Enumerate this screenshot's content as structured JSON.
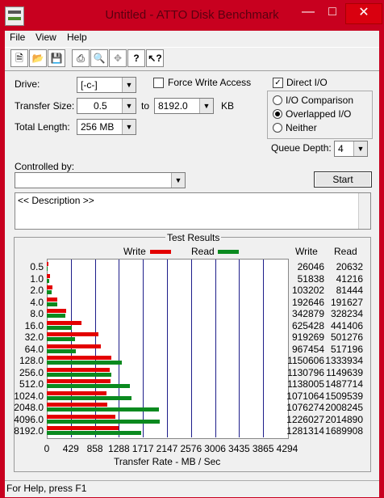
{
  "window": {
    "title": "Untitled - ATTO Disk Benchmark"
  },
  "menu": {
    "file": "File",
    "view": "View",
    "help": "Help"
  },
  "form": {
    "drive_label": "Drive:",
    "drive_value": "[-c-]",
    "transfer_size_label": "Transfer Size:",
    "transfer_from": "0.5",
    "to_label": "to",
    "transfer_to": "8192.0",
    "kb_label": "KB",
    "total_length_label": "Total Length:",
    "total_length_value": "256 MB",
    "force_write_label": "Force Write Access",
    "force_write_checked": false,
    "direct_io_label": "Direct I/O",
    "direct_io_checked": true,
    "io_comparison_label": "I/O Comparison",
    "overlapped_io_label": "Overlapped I/O",
    "neither_label": "Neither",
    "io_mode_selected": "Overlapped I/O",
    "queue_depth_label": "Queue Depth:",
    "queue_depth_value": "4",
    "controlled_by_label": "Controlled by:",
    "controlled_by_value": "",
    "start_label": "Start",
    "description_text": "<< Description >>"
  },
  "results": {
    "group_title": "Test Results",
    "legend_write": "Write",
    "legend_read": "Read",
    "col_write": "Write",
    "col_read": "Read",
    "write_color": "#e30000",
    "read_color": "#0a8a1f"
  },
  "chart_data": {
    "type": "bar",
    "orientation": "horizontal",
    "xlabel": "Transfer Rate - MB / Sec",
    "xlim": [
      0,
      4294
    ],
    "xticks": [
      "0",
      "429",
      "858",
      "1288",
      "1717",
      "2147",
      "2576",
      "3006",
      "3435",
      "3865",
      "4294"
    ],
    "categories": [
      "0.5",
      "1.0",
      "2.0",
      "4.0",
      "8.0",
      "16.0",
      "32.0",
      "64.0",
      "128.0",
      "256.0",
      "512.0",
      "1024.0",
      "2048.0",
      "4096.0",
      "8192.0"
    ],
    "series": [
      {
        "name": "Write",
        "values": [
          26046,
          51838,
          103202,
          192646,
          342879,
          625428,
          919269,
          967454,
          1150606,
          1130796,
          1138005,
          1071064,
          1076274,
          1226027,
          1281314
        ]
      },
      {
        "name": "Read",
        "values": [
          20632,
          41216,
          81444,
          191627,
          328234,
          441406,
          501276,
          517196,
          1333934,
          1149639,
          1487714,
          1509539,
          2008245,
          2014890,
          1689908
        ]
      }
    ]
  },
  "status": {
    "text": "For Help, press F1"
  }
}
